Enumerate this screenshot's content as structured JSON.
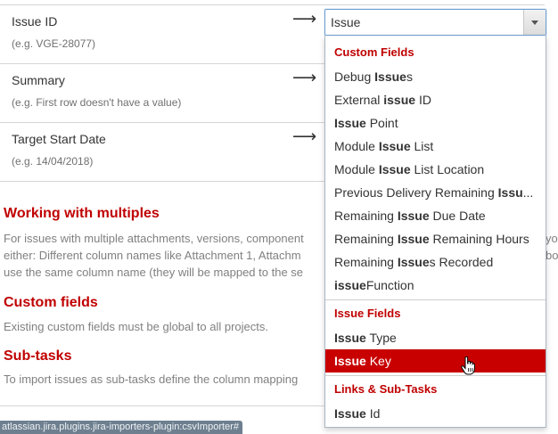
{
  "mapping_rows": [
    {
      "label": "Issue ID",
      "hint": "(e.g. VGE-28077)",
      "arrow": "⟶"
    },
    {
      "label": "Summary",
      "hint": "(e.g. First row doesn't have a value)",
      "arrow": "⟶"
    },
    {
      "label": "Target Start Date",
      "hint": "(e.g. 14/04/2018)",
      "arrow": "⟶"
    }
  ],
  "sections": {
    "multiples": {
      "title": "Working with multiples",
      "lines": [
        "For issues with multiple attachments, versions, component",
        "either: Different column names like Attachment 1, Attachm",
        "use the same column name (they will be mapped to the se"
      ],
      "line1_tail": "yo",
      "line2_tail": "bo"
    },
    "custom": {
      "title": "Custom fields",
      "text": "Existing custom fields must be global to all projects."
    },
    "subtasks": {
      "title": "Sub-tasks",
      "text": "To import issues as sub-tasks define the column mapping"
    }
  },
  "status_bar": "atlassian.jira.plugins.jira-importers-plugin:csvImporter#",
  "select": {
    "value": "Issue",
    "groups": [
      {
        "label": "Custom Fields",
        "options": [
          {
            "pre": "Debug ",
            "bold": "Issue",
            "post": "s"
          },
          {
            "pre": "External ",
            "bold": "issue",
            "post": " ID"
          },
          {
            "pre": "",
            "bold": "Issue",
            "post": " Point"
          },
          {
            "pre": "Module ",
            "bold": "Issue",
            "post": " List"
          },
          {
            "pre": "Module ",
            "bold": "Issue",
            "post": " List Location"
          },
          {
            "pre": "Previous Delivery Remaining ",
            "bold": "Issu",
            "post": "..."
          },
          {
            "pre": "Remaining ",
            "bold": "Issue",
            "post": " Due Date"
          },
          {
            "pre": "Remaining ",
            "bold": "Issue",
            "post": " Remaining Hours"
          },
          {
            "pre": "Remaining ",
            "bold": "Issue",
            "post": "s Recorded"
          },
          {
            "pre": "",
            "bold": "issue",
            "post": "Function"
          }
        ]
      },
      {
        "label": "Issue Fields",
        "options": [
          {
            "pre": "",
            "bold": "Issue",
            "post": " Type"
          },
          {
            "pre": "",
            "bold": "Issue",
            "post": " Key",
            "selected": true
          }
        ]
      },
      {
        "label": "Links & Sub-Tasks",
        "options": [
          {
            "pre": "",
            "bold": "Issue",
            "post": " Id"
          }
        ]
      }
    ]
  },
  "colors": {
    "accent": "#c00000",
    "selected_bg": "#c80000"
  },
  "icons": {
    "select_arrow": "chevron-down-icon",
    "cursor": "hand-pointer-icon"
  }
}
